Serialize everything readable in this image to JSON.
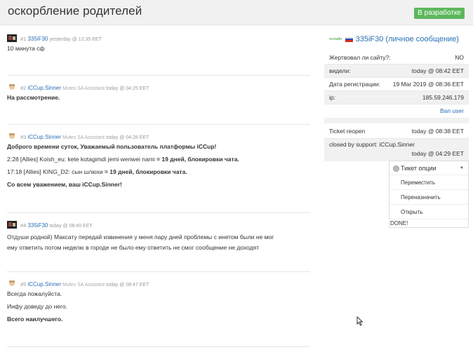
{
  "header": {
    "title": "оскорбление родителей",
    "status": "В разработке",
    "status_color": "#5cb85c"
  },
  "posts": [
    {
      "num": "#1",
      "author": "335iF30",
      "role": "",
      "date": "yesterday @ 12:35 EET",
      "avatar": "avatar-dark",
      "lines": [
        "10 минута сф"
      ]
    },
    {
      "num": "#2",
      "author": "iCCup.Sinner",
      "role": "Mutes SA Assistant",
      "date": "today @ 04:25 EET",
      "avatar": "avatar-light",
      "lines": [
        "На рассмотрение."
      ]
    },
    {
      "num": "#3",
      "author": "iCCup.Sinner",
      "role": "Mutes SA Assistant",
      "date": "today @ 04:28 EET",
      "avatar": "avatar-light",
      "lines": [
        "Доброго времени суток, Уважаемый пользователь платформы iCCup!",
        "2:28 [Allies] Koish_eu: kete kotagimdi jemi wenwei nami",
        " = 19 дней, блокировки чата.",
        "17:18 [Allies] KING_D2: сын шлюхи",
        " = 19 дней, блокировки чата.",
        "Со всем уважением, ваш iCCup.Sinner!"
      ]
    },
    {
      "num": "#4",
      "author": "335iF30",
      "role": "",
      "date": "today @ 08:40 EET",
      "avatar": "avatar-dark",
      "lines": [
        "Отдуши родной) Максату передай извинения у меня пару дней проблемы с инетом были не мог",
        "ему ответить потом неделю в городе не было ему ответить не смог сообщение не доходят"
      ]
    },
    {
      "num": "#5",
      "author": "iCCup.Sinner",
      "role": "Mutes SA Assistant",
      "date": "today @ 08:47 EET",
      "avatar": "avatar-light",
      "lines": [
        "Всегда пожалуйста.",
        "Инфу доведу до него.",
        "Всего наилучшего."
      ]
    }
  ],
  "sidebar": {
    "online_label": "онлайн",
    "user_link": "335iF30 (личное сообщение)",
    "info": [
      {
        "label": "Жертвовал ли сайту?:",
        "value": "NO"
      },
      {
        "label": "видели:",
        "value": "today @ 08:42 EET"
      },
      {
        "label": "Дата регистрации:",
        "value": "19 Mar 2019 @ 08:36 EET"
      },
      {
        "label": "ip:",
        "value": "185.59.246.179"
      }
    ],
    "ban_label": "Ban user",
    "ticket": [
      {
        "label": "Ticket reopen",
        "value": "today @ 08:38 EET"
      },
      {
        "label": "closed by support: iCCup.Sinner",
        "value": "today @ 04:29 EET"
      }
    ]
  },
  "options": {
    "title": "Тикет опции",
    "items": [
      "Переместить",
      "Переназначить",
      "Открыть"
    ],
    "done": "DONE!"
  }
}
